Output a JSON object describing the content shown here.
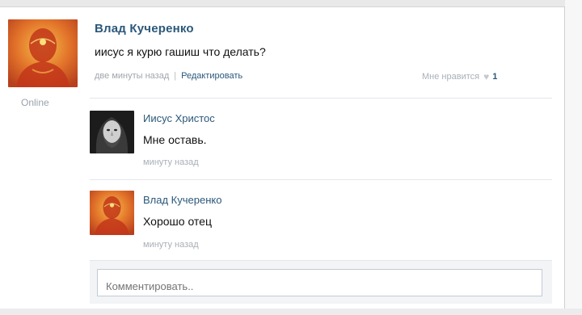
{
  "post": {
    "author": "Влад Кучеренко",
    "status": "Online",
    "text": "иисус я курю гашиш что делать?",
    "time": "две минуты назад",
    "separator": "|",
    "edit_label": "Редактировать",
    "like_label": "Мне нравится",
    "like_count": "1",
    "like_icon": "heart-icon"
  },
  "comments": [
    {
      "author": "Иисус Христос",
      "text": "Мне оставь.",
      "time": "минуту назад",
      "avatar": "portrait-dark"
    },
    {
      "author": "Влад Кучеренко",
      "text": "Хорошо отец",
      "time": "минуту назад",
      "avatar": "portrait-orange"
    }
  ],
  "reply": {
    "placeholder": "Комментировать.."
  },
  "colors": {
    "link": "#2b587a",
    "muted": "#a0a6ad",
    "divider": "#e3e6ea",
    "reply_bg": "#f2f4f6"
  }
}
